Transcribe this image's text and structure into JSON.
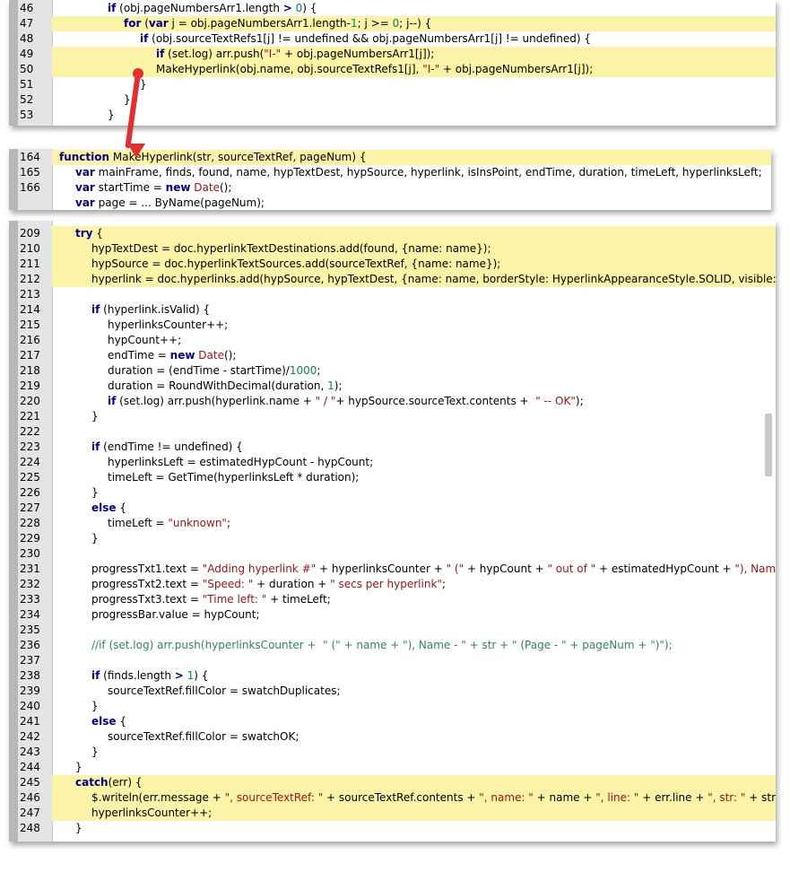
{
  "panel1": {
    "lines": [
      {
        "n": "46",
        "hl": false,
        "indent": 3,
        "parts": [
          [
            "kw",
            "if"
          ],
          [
            "",
            " (obj.pageNumbersArr1.length "
          ],
          [
            "kw",
            ">"
          ],
          [
            "",
            " "
          ],
          [
            "num",
            "0"
          ],
          [
            "",
            ") {"
          ]
        ]
      },
      {
        "n": "47",
        "hl": true,
        "indent": 4,
        "parts": [
          [
            "kw",
            "for"
          ],
          [
            "",
            " ("
          ],
          [
            "kw",
            "var"
          ],
          [
            "",
            " j = obj.pageNumbersArr1.length-"
          ],
          [
            "num",
            "1"
          ],
          [
            "",
            "; j >= "
          ],
          [
            "num",
            "0"
          ],
          [
            "",
            "; j--) {"
          ]
        ]
      },
      {
        "n": "48",
        "hl": false,
        "indent": 5,
        "parts": [
          [
            "kw",
            "if"
          ],
          [
            "",
            " (obj.sourceTextRefs1[j] != undefined && obj.pageNumbersArr1[j] != undefined) {"
          ]
        ]
      },
      {
        "n": "49",
        "hl": true,
        "indent": 6,
        "parts": [
          [
            "kw",
            "if"
          ],
          [
            "",
            " (set.log) arr.push("
          ],
          [
            "str",
            "\"I-\""
          ],
          [
            "",
            " + obj.pageNumbersArr1[j]);"
          ]
        ]
      },
      {
        "n": "50",
        "hl": true,
        "indent": 6,
        "parts": [
          [
            "",
            "MakeHyperlink(obj.name, obj.sourceTextRefs1[j], "
          ],
          [
            "str",
            "\"I-\""
          ],
          [
            "",
            " + obj.pageNumbersArr1[j]);"
          ]
        ]
      },
      {
        "n": "51",
        "hl": false,
        "indent": 5,
        "parts": [
          [
            "",
            "}"
          ]
        ]
      },
      {
        "n": "52",
        "hl": false,
        "indent": 4,
        "parts": [
          [
            "",
            "}"
          ]
        ]
      },
      {
        "n": "53",
        "hl": false,
        "indent": 3,
        "parts": [
          [
            "",
            "}"
          ]
        ]
      }
    ]
  },
  "panel2": {
    "lines": [
      {
        "n": "164",
        "hl": true,
        "indent": 0,
        "parts": [
          [
            "kw",
            "function"
          ],
          [
            "",
            " MakeHyperlink(str, sourceTextRef, pageNum) {"
          ]
        ]
      },
      {
        "n": "165",
        "hl": false,
        "indent": 1,
        "parts": [
          [
            "kw",
            "var"
          ],
          [
            "",
            " mainFrame, finds, found, name, hypTextDest, hypSource, hyperlink, isInsPoint, endTime, duration, timeLeft, hyperlinksLeft;"
          ]
        ]
      },
      {
        "n": "166",
        "hl": false,
        "indent": 1,
        "parts": [
          [
            "kw",
            "var"
          ],
          [
            "",
            " startTime = "
          ],
          [
            "kw",
            "new"
          ],
          [
            "",
            " "
          ],
          [
            "str",
            "Date"
          ],
          [
            "",
            "();"
          ]
        ]
      },
      {
        "n": "",
        "hl": false,
        "indent": 1,
        "parts": [
          [
            "kw",
            "var"
          ],
          [
            "",
            " page = ... ByName(pageNum);"
          ]
        ]
      }
    ]
  },
  "panel3": {
    "lines": [
      {
        "n": "209",
        "hl": true,
        "indent": 1,
        "parts": [
          [
            "kw",
            "try"
          ],
          [
            "",
            " {"
          ]
        ]
      },
      {
        "n": "210",
        "hl": true,
        "indent": 2,
        "parts": [
          [
            "",
            "hypTextDest = doc.hyperlinkTextDestinations.add(found, {name: name});"
          ]
        ]
      },
      {
        "n": "211",
        "hl": true,
        "indent": 2,
        "parts": [
          [
            "",
            "hypSource = doc.hyperlinkTextSources.add(sourceTextRef, {name: name});"
          ]
        ]
      },
      {
        "n": "212",
        "hl": true,
        "indent": 2,
        "parts": [
          [
            "",
            "hyperlink = doc.hyperlinks.add(hypSource, hypTextDest, {name: name, borderStyle: HyperlinkAppearanceStyle.SOLID, visible: "
          ],
          [
            "kw",
            "false"
          ],
          [
            "",
            "}"
          ]
        ]
      },
      {
        "n": "213",
        "hl": false,
        "indent": 0,
        "parts": []
      },
      {
        "n": "214",
        "hl": false,
        "indent": 2,
        "parts": [
          [
            "kw",
            "if"
          ],
          [
            "",
            " (hyperlink.isValid) {"
          ]
        ]
      },
      {
        "n": "215",
        "hl": false,
        "indent": 3,
        "parts": [
          [
            "",
            "hyperlinksCounter++;"
          ]
        ]
      },
      {
        "n": "216",
        "hl": false,
        "indent": 3,
        "parts": [
          [
            "",
            "hypCount++;"
          ]
        ]
      },
      {
        "n": "217",
        "hl": false,
        "indent": 3,
        "parts": [
          [
            "",
            "endTime = "
          ],
          [
            "kw",
            "new"
          ],
          [
            "",
            " "
          ],
          [
            "str",
            "Date"
          ],
          [
            "",
            "();"
          ]
        ]
      },
      {
        "n": "218",
        "hl": false,
        "indent": 3,
        "parts": [
          [
            "",
            "duration = (endTime - startTime)/"
          ],
          [
            "num",
            "1000"
          ],
          [
            "",
            ";"
          ]
        ]
      },
      {
        "n": "219",
        "hl": false,
        "indent": 3,
        "parts": [
          [
            "",
            "duration = RoundWithDecimal(duration, "
          ],
          [
            "num",
            "1"
          ],
          [
            "",
            ");"
          ]
        ]
      },
      {
        "n": "220",
        "hl": false,
        "indent": 3,
        "parts": [
          [
            "kw",
            "if"
          ],
          [
            "",
            " (set.log) arr.push(hyperlink.name + "
          ],
          [
            "str",
            "\" / \""
          ],
          [
            "",
            "+ hypSource.sourceText.contents +  "
          ],
          [
            "str",
            "\" -- OK\""
          ],
          [
            "",
            ");"
          ]
        ]
      },
      {
        "n": "221",
        "hl": false,
        "indent": 2,
        "parts": [
          [
            "",
            "}"
          ]
        ]
      },
      {
        "n": "222",
        "hl": false,
        "indent": 0,
        "parts": []
      },
      {
        "n": "223",
        "hl": false,
        "indent": 2,
        "parts": [
          [
            "kw",
            "if"
          ],
          [
            "",
            " (endTime != undefined) {"
          ]
        ]
      },
      {
        "n": "224",
        "hl": false,
        "indent": 3,
        "parts": [
          [
            "",
            "hyperlinksLeft = estimatedHypCount - hypCount;"
          ]
        ]
      },
      {
        "n": "225",
        "hl": false,
        "indent": 3,
        "parts": [
          [
            "",
            "timeLeft = GetTime(hyperlinksLeft * duration);"
          ]
        ]
      },
      {
        "n": "226",
        "hl": false,
        "indent": 2,
        "parts": [
          [
            "",
            "}"
          ]
        ]
      },
      {
        "n": "227",
        "hl": false,
        "indent": 2,
        "parts": [
          [
            "kw",
            "else"
          ],
          [
            "",
            " {"
          ]
        ]
      },
      {
        "n": "228",
        "hl": false,
        "indent": 3,
        "parts": [
          [
            "",
            "timeLeft = "
          ],
          [
            "str",
            "\"unknown\""
          ],
          [
            "",
            ";"
          ]
        ]
      },
      {
        "n": "229",
        "hl": false,
        "indent": 2,
        "parts": [
          [
            "",
            "}"
          ]
        ]
      },
      {
        "n": "230",
        "hl": false,
        "indent": 0,
        "parts": []
      },
      {
        "n": "231",
        "hl": false,
        "indent": 2,
        "parts": [
          [
            "",
            "progressTxt1.text = "
          ],
          [
            "str",
            "\"Adding hyperlink #\""
          ],
          [
            "",
            " + hyperlinksCounter + "
          ],
          [
            "str",
            "\" (\""
          ],
          [
            "",
            " + hypCount + "
          ],
          [
            "str",
            "\" out of \""
          ],
          [
            "",
            " + estimatedHypCount + "
          ],
          [
            "str",
            "\"), Name: \""
          ],
          [
            "",
            " +"
          ]
        ]
      },
      {
        "n": "232",
        "hl": false,
        "indent": 2,
        "parts": [
          [
            "",
            "progressTxt2.text = "
          ],
          [
            "str",
            "\"Speed: \""
          ],
          [
            "",
            " + duration + "
          ],
          [
            "str",
            "\" secs per hyperlink\""
          ],
          [
            "",
            ";"
          ]
        ]
      },
      {
        "n": "233",
        "hl": false,
        "indent": 2,
        "parts": [
          [
            "",
            "progressTxt3.text = "
          ],
          [
            "str",
            "\"Time left: \""
          ],
          [
            "",
            " + timeLeft;"
          ]
        ]
      },
      {
        "n": "234",
        "hl": false,
        "indent": 2,
        "parts": [
          [
            "",
            "progressBar.value = hypCount;"
          ]
        ]
      },
      {
        "n": "235",
        "hl": false,
        "indent": 0,
        "parts": []
      },
      {
        "n": "236",
        "hl": false,
        "indent": 2,
        "parts": [
          [
            "cmt",
            "//if (set.log) arr.push(hyperlinksCounter +  \" (\" + name + \"), Name - \" + str + \" (Page - \" + pageNum + \")\");"
          ]
        ]
      },
      {
        "n": "237",
        "hl": false,
        "indent": 0,
        "parts": []
      },
      {
        "n": "238",
        "hl": false,
        "indent": 2,
        "parts": [
          [
            "kw",
            "if"
          ],
          [
            "",
            " (finds.length "
          ],
          [
            "kw",
            ">"
          ],
          [
            "",
            " "
          ],
          [
            "num",
            "1"
          ],
          [
            "",
            ") {"
          ]
        ]
      },
      {
        "n": "239",
        "hl": false,
        "indent": 3,
        "parts": [
          [
            "",
            "sourceTextRef.fillColor = swatchDuplicates;"
          ]
        ]
      },
      {
        "n": "240",
        "hl": false,
        "indent": 2,
        "parts": [
          [
            "",
            "}"
          ]
        ]
      },
      {
        "n": "241",
        "hl": false,
        "indent": 2,
        "parts": [
          [
            "kw",
            "else"
          ],
          [
            "",
            " {"
          ]
        ]
      },
      {
        "n": "242",
        "hl": false,
        "indent": 3,
        "parts": [
          [
            "",
            "sourceTextRef.fillColor = swatchOK;"
          ]
        ]
      },
      {
        "n": "243",
        "hl": false,
        "indent": 2,
        "parts": [
          [
            "",
            "}"
          ]
        ]
      },
      {
        "n": "244",
        "hl": false,
        "indent": 1,
        "parts": [
          [
            "",
            "}"
          ]
        ]
      },
      {
        "n": "245",
        "hl": true,
        "indent": 1,
        "parts": [
          [
            "kw",
            "catch"
          ],
          [
            "",
            "(err) {"
          ]
        ]
      },
      {
        "n": "246",
        "hl": true,
        "indent": 2,
        "parts": [
          [
            "",
            "$.writeln(err.message + "
          ],
          [
            "str",
            "\", sourceTextRef: \""
          ],
          [
            "",
            " + sourceTextRef.contents + "
          ],
          [
            "str",
            "\", name: \""
          ],
          [
            "",
            " + name + "
          ],
          [
            "str",
            "\", line: \""
          ],
          [
            "",
            " + err.line + "
          ],
          [
            "str",
            "\", str: \""
          ],
          [
            "",
            " + str +"
          ]
        ]
      },
      {
        "n": "247",
        "hl": true,
        "indent": 2,
        "parts": [
          [
            "",
            "hyperlinksCounter++;"
          ]
        ]
      },
      {
        "n": "248",
        "hl": false,
        "indent": 1,
        "parts": [
          [
            "",
            "}"
          ]
        ]
      }
    ]
  },
  "colors": {
    "highlight": "#fbf3a6",
    "keyword": "#00008b",
    "string": "#a31515",
    "number": "#098658",
    "comment": "#2e8b57",
    "arrow": "#e03030"
  }
}
